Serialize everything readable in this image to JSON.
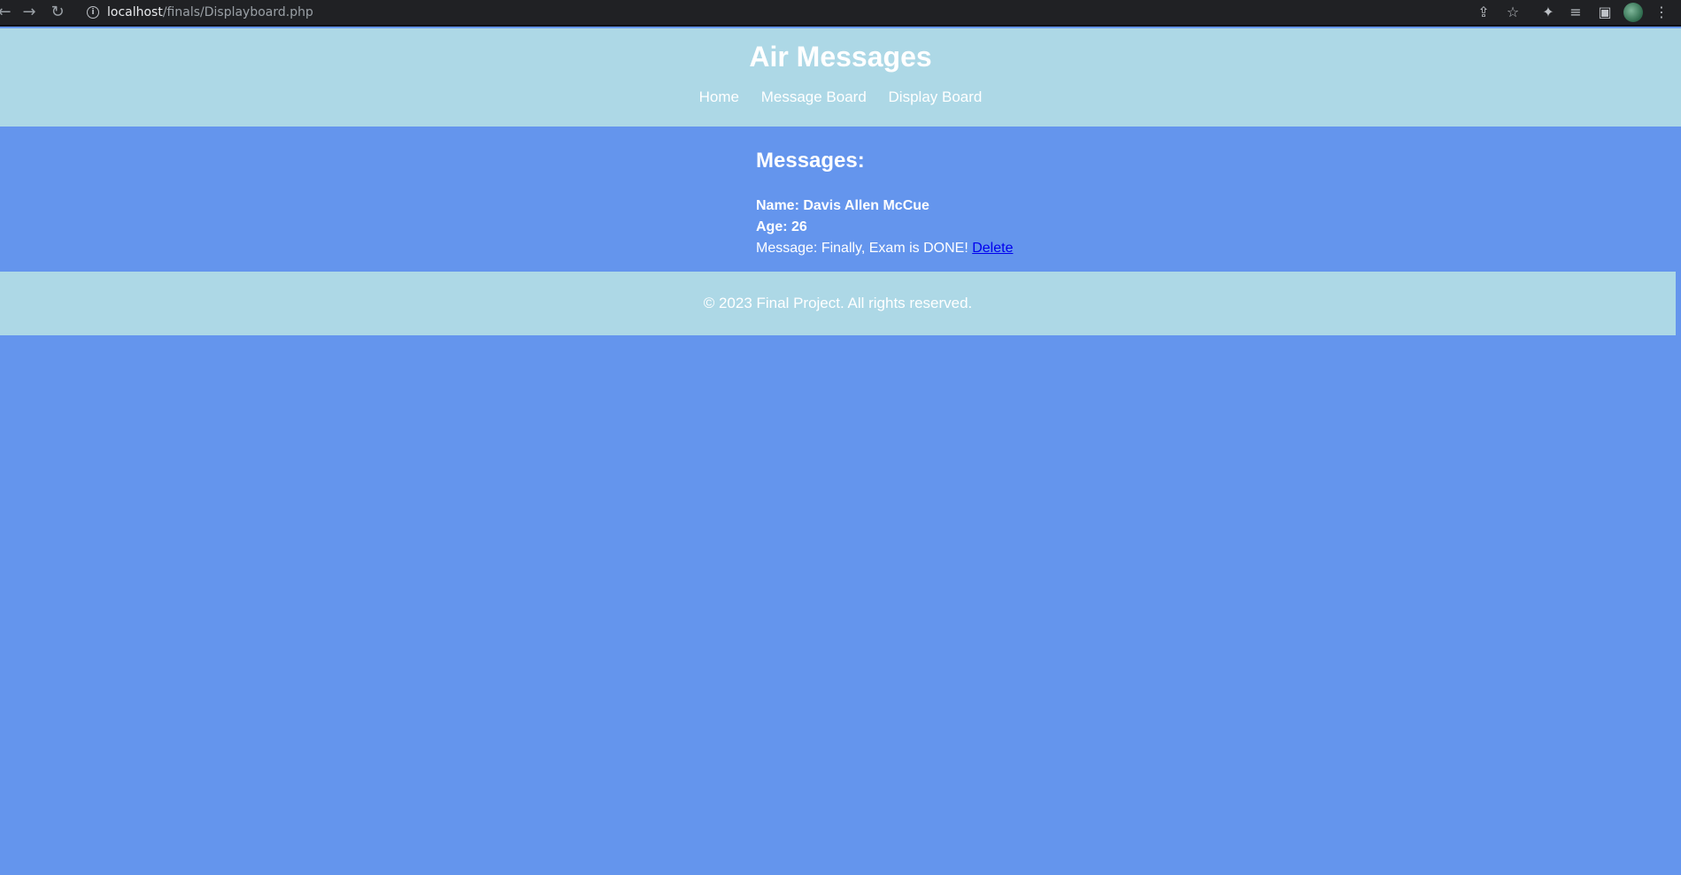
{
  "browser": {
    "url_host": "localhost",
    "url_path": "/finals/Displayboard.php"
  },
  "header": {
    "title": "Air Messages",
    "nav": [
      "Home",
      "Message Board",
      "Display Board"
    ]
  },
  "main": {
    "heading": "Messages:",
    "message": {
      "name_label": "Name: Davis Allen McCue",
      "age_label": "Age: 26",
      "message_label": "Message: Finally, Exam is DONE!",
      "delete_label": "Delete"
    }
  },
  "footer": {
    "text": "© 2023 Final Project. All rights reserved."
  }
}
